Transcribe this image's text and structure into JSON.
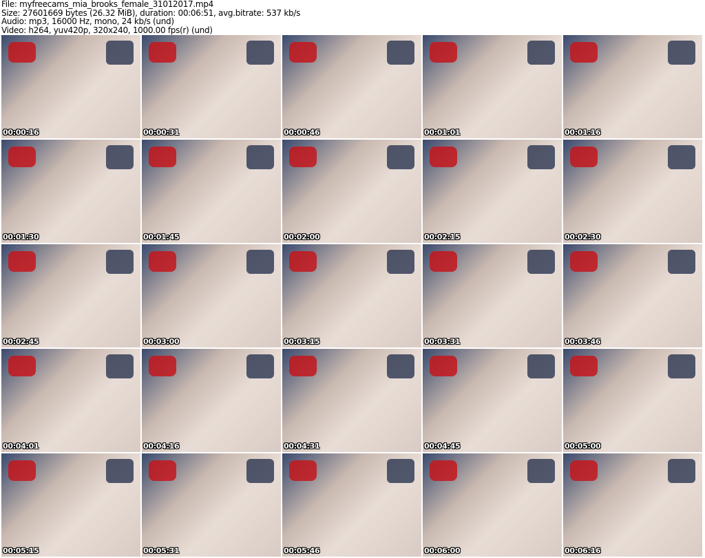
{
  "header": {
    "file": "File: myfreecams_mia_brooks_female_31012017.mp4",
    "size": "Size: 27601669 bytes (26.32 MiB), duration: 00:06:51, avg.bitrate: 537 kb/s",
    "audio": "Audio: mp3, 16000 Hz, mono, 24 kb/s (und)",
    "video": "Video: h264, yuv420p, 320x240, 1000.00 fps(r) (und)"
  },
  "thumbnails": [
    {
      "timestamp": "00:00:16"
    },
    {
      "timestamp": "00:00:31"
    },
    {
      "timestamp": "00:00:46"
    },
    {
      "timestamp": "00:01:01"
    },
    {
      "timestamp": "00:01:16"
    },
    {
      "timestamp": "00:01:30"
    },
    {
      "timestamp": "00:01:45"
    },
    {
      "timestamp": "00:02:00"
    },
    {
      "timestamp": "00:02:15"
    },
    {
      "timestamp": "00:02:30"
    },
    {
      "timestamp": "00:02:45"
    },
    {
      "timestamp": "00:03:00"
    },
    {
      "timestamp": "00:03:15"
    },
    {
      "timestamp": "00:03:31"
    },
    {
      "timestamp": "00:03:46"
    },
    {
      "timestamp": "00:04:01"
    },
    {
      "timestamp": "00:04:16"
    },
    {
      "timestamp": "00:04:31"
    },
    {
      "timestamp": "00:04:45"
    },
    {
      "timestamp": "00:05:00"
    },
    {
      "timestamp": "00:05:15"
    },
    {
      "timestamp": "00:05:31"
    },
    {
      "timestamp": "00:05:46"
    },
    {
      "timestamp": "00:06:00"
    },
    {
      "timestamp": "00:06:16"
    }
  ]
}
